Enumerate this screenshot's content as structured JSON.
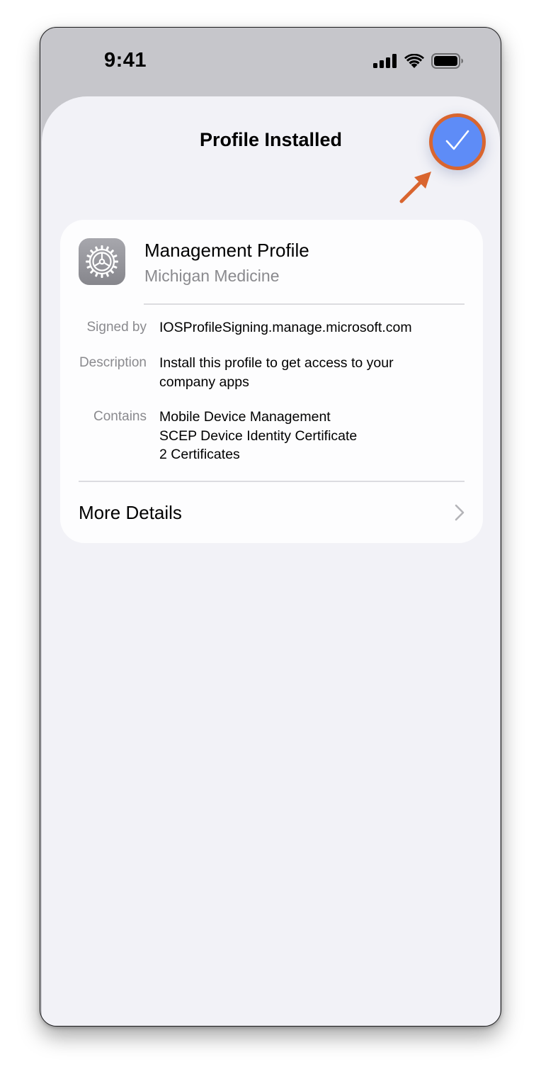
{
  "status_bar": {
    "time": "9:41"
  },
  "sheet": {
    "title": "Profile Installed",
    "done_icon": "checkmark-icon",
    "annotation": {
      "arrow_color": "#d9652f",
      "highlight_ring_color": "#d9652f"
    },
    "accent_color": "#5e8cf7"
  },
  "profile": {
    "icon": "gear-settings-icon",
    "name": "Management Profile",
    "organization": "Michigan Medicine",
    "rows": [
      {
        "label": "Signed by",
        "value": "IOSProfileSigning.manage.microsoft.com"
      },
      {
        "label": "Description",
        "value": "Install this profile to get access to your company apps"
      },
      {
        "label": "Contains",
        "lines": [
          "Mobile Device Management",
          "SCEP Device Identity Certificate",
          "2 Certificates"
        ]
      }
    ],
    "more_details_label": "More Details",
    "more_details_icon": "chevron-right-icon"
  }
}
